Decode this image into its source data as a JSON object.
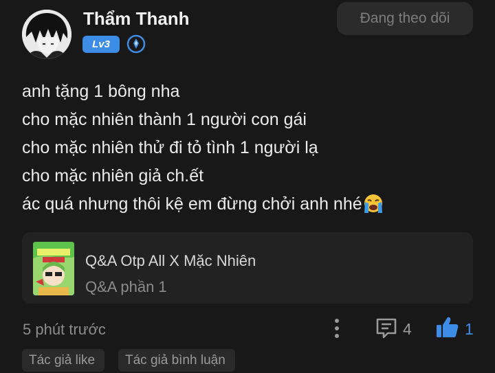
{
  "user": {
    "name": "Thẩm Thanh",
    "level": "Lv3",
    "follow_label": "Đang theo dõi"
  },
  "post": {
    "lines": [
      "anh tặng 1 bông nha",
      "cho mặc nhiên thành 1 người con gái",
      "cho mặc nhiên thử đi tỏ tình 1 người lạ",
      "cho mặc nhiên giả ch.ết",
      "ác quá nhưng thôi kệ em đừng chởi anh nhé"
    ],
    "trailing_emoji": "crying-face-icon"
  },
  "linked_story": {
    "title": "Q&A Otp All X Mặc Nhiên",
    "chapter": "Q&A phần 1"
  },
  "footer": {
    "time": "5 phút trước",
    "comment_count": "4",
    "like_count": "1",
    "tags": [
      "Tác giả like",
      "Tác giả bình luận"
    ]
  },
  "colors": {
    "background": "#181818",
    "accent": "#3d8de6",
    "muted_text": "#8c8c8c"
  }
}
